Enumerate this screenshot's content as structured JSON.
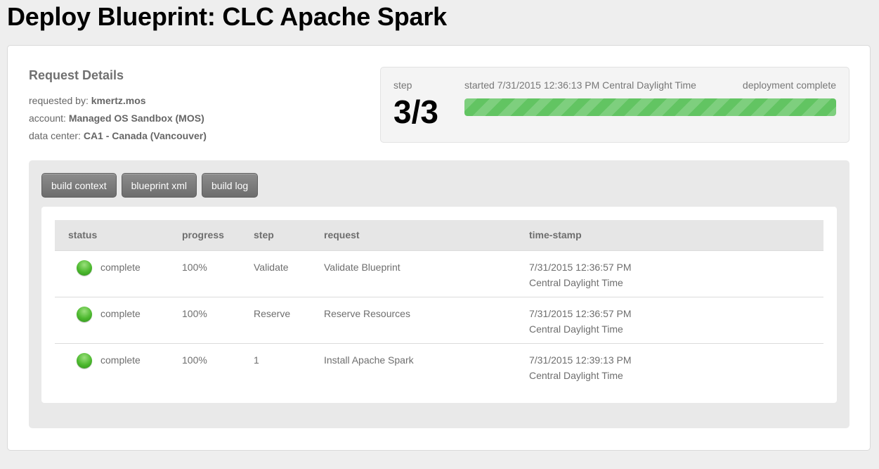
{
  "page": {
    "title": "Deploy Blueprint: CLC Apache Spark"
  },
  "request_details": {
    "heading": "Request Details",
    "requested_by_label": "requested by:",
    "requested_by_value": "kmertz.mos",
    "account_label": "account:",
    "account_value": "Managed OS Sandbox (MOS)",
    "data_center_label": "data center:",
    "data_center_value": "CA1 - Canada (Vancouver)"
  },
  "step_box": {
    "step_label": "step",
    "step_value": "3/3",
    "started_text": "started 7/31/2015 12:36:13 PM Central Daylight Time",
    "status_text": "deployment complete",
    "progress_percent": 100,
    "progress_color": "#62c462"
  },
  "tabs": [
    {
      "label": "build context"
    },
    {
      "label": "blueprint xml"
    },
    {
      "label": "build log"
    }
  ],
  "table": {
    "headers": [
      "status",
      "progress",
      "step",
      "request",
      "time-stamp"
    ],
    "rows": [
      {
        "status_icon": "green-status-dot-icon",
        "status": "complete",
        "progress": "100%",
        "step": "Validate",
        "request": "Validate Blueprint",
        "timestamp_line1": "7/31/2015 12:36:57 PM",
        "timestamp_line2": "Central Daylight Time"
      },
      {
        "status_icon": "green-status-dot-icon",
        "status": "complete",
        "progress": "100%",
        "step": "Reserve",
        "request": "Reserve Resources",
        "timestamp_line1": "7/31/2015 12:36:57 PM",
        "timestamp_line2": "Central Daylight Time"
      },
      {
        "status_icon": "green-status-dot-icon",
        "status": "complete",
        "progress": "100%",
        "step": "1",
        "request": "Install Apache Spark",
        "timestamp_line1": "7/31/2015 12:39:13 PM",
        "timestamp_line2": "Central Daylight Time"
      }
    ]
  }
}
